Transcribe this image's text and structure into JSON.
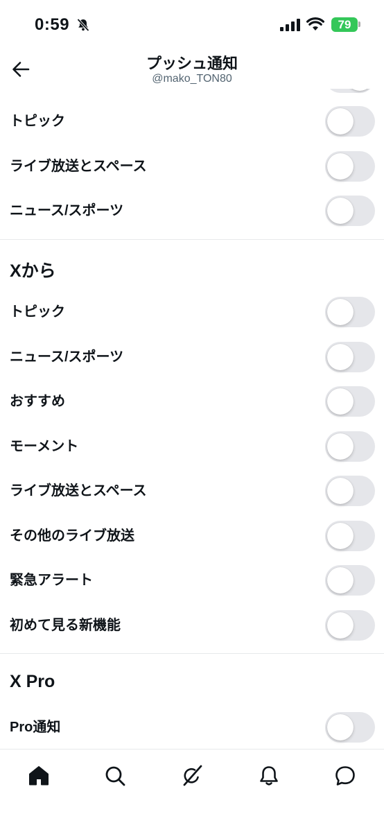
{
  "status_bar": {
    "time": "0:59",
    "battery": "79"
  },
  "header": {
    "title": "プッシュ通知",
    "subtitle": "@mako_TON80"
  },
  "section_top_rows": [
    {
      "label": "トピック",
      "on": false
    },
    {
      "label": "ライブ放送とスペース",
      "on": false
    },
    {
      "label": "ニュース/スポーツ",
      "on": false
    }
  ],
  "section_from_x": {
    "title": "Xから",
    "rows": [
      {
        "label": "トピック",
        "on": false
      },
      {
        "label": "ニュース/スポーツ",
        "on": false
      },
      {
        "label": "おすすめ",
        "on": false
      },
      {
        "label": "モーメント",
        "on": false
      },
      {
        "label": "ライブ放送とスペース",
        "on": false
      },
      {
        "label": "その他のライブ放送",
        "on": false
      },
      {
        "label": "緊急アラート",
        "on": false
      },
      {
        "label": "初めて見る新機能",
        "on": false
      }
    ]
  },
  "section_x_pro": {
    "title": "X Pro",
    "rows": [
      {
        "label": "Pro通知",
        "on": false
      }
    ]
  },
  "tab_bar": {
    "icons": [
      "home-icon",
      "search-icon",
      "grok-icon",
      "notifications-icon",
      "messages-icon"
    ],
    "active": "home-icon"
  }
}
